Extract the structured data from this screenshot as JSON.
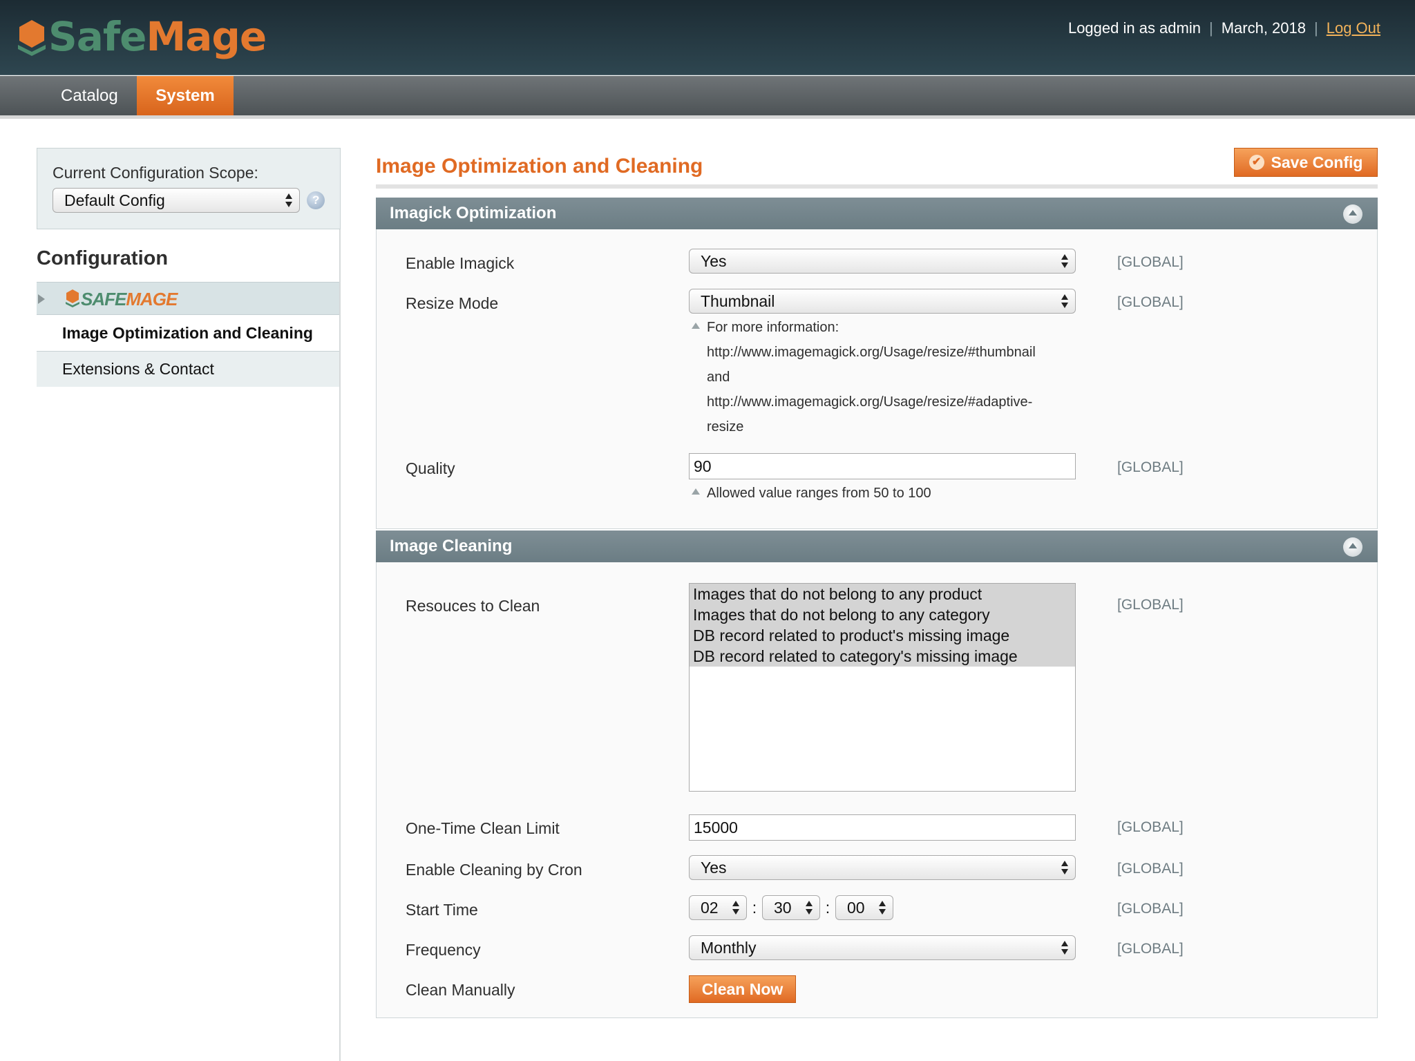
{
  "header": {
    "logo_safe": "Safe",
    "logo_mage": "Mage",
    "logged_in": "Logged in as admin",
    "date": "March, 2018",
    "logout": "Log Out"
  },
  "nav": {
    "catalog": "Catalog",
    "system": "System"
  },
  "sidebar": {
    "scope_label": "Current Configuration Scope:",
    "scope_value": "Default Config",
    "help": "?",
    "config_title": "Configuration",
    "group_logo_safe": "SAFE",
    "group_logo_mage": "MAGE",
    "items": [
      {
        "label": "Image Optimization and Cleaning",
        "active": true
      },
      {
        "label": "Extensions & Contact",
        "active": false
      }
    ]
  },
  "main": {
    "title": "Image Optimization and Cleaning",
    "save_label": "Save Config",
    "scope_tag": "[GLOBAL]",
    "imagick": {
      "title": "Imagick Optimization",
      "enable_label": "Enable Imagick",
      "enable_value": "Yes",
      "resize_label": "Resize Mode",
      "resize_value": "Thumbnail",
      "resize_note_1": "For more information:",
      "resize_note_2": "http://www.imagemagick.org/Usage/resize/#thumbnail",
      "resize_note_3": "and",
      "resize_note_4": "http://www.imagemagick.org/Usage/resize/#adaptive-",
      "resize_note_5": "resize",
      "quality_label": "Quality",
      "quality_value": "90",
      "quality_note": "Allowed value ranges from 50 to 100"
    },
    "cleaning": {
      "title": "Image Cleaning",
      "resources_label": "Resouces to Clean",
      "resources_options": [
        "Images that do not belong to any product",
        "Images that do not belong to any category",
        "DB record related to product's missing image",
        "DB record related to category's missing image"
      ],
      "limit_label": "One-Time Clean Limit",
      "limit_value": "15000",
      "cron_label": "Enable Cleaning by Cron",
      "cron_value": "Yes",
      "start_label": "Start Time",
      "start_hour": "02",
      "start_minute": "30",
      "start_second": "00",
      "time_sep": ":",
      "frequency_label": "Frequency",
      "frequency_value": "Monthly",
      "manual_label": "Clean Manually",
      "clean_button": "Clean Now"
    }
  },
  "colors": {
    "accent": "#e06a23",
    "header_bg": "#243840",
    "section_head": "#758890"
  }
}
